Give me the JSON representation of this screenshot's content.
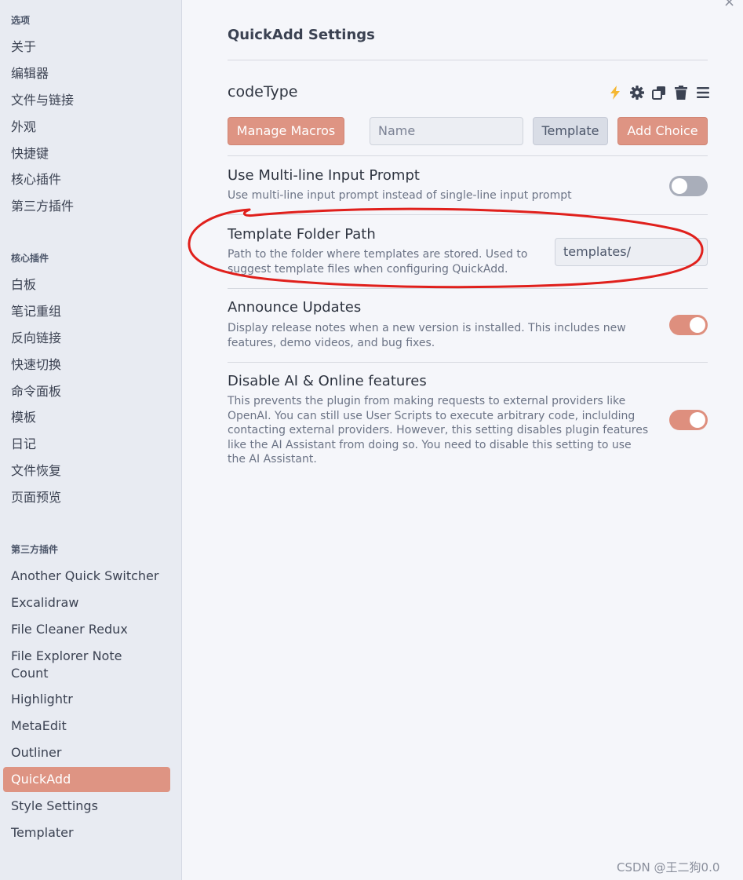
{
  "window": {
    "close_glyph": "×"
  },
  "sidebar": {
    "options_title": "选项",
    "options_items": [
      {
        "label": "关于"
      },
      {
        "label": "编辑器"
      },
      {
        "label": "文件与链接"
      },
      {
        "label": "外观"
      },
      {
        "label": "快捷键"
      },
      {
        "label": "核心插件"
      },
      {
        "label": "第三方插件"
      }
    ],
    "core_title": "核心插件",
    "core_items": [
      {
        "label": "白板"
      },
      {
        "label": "笔记重组"
      },
      {
        "label": "反向链接"
      },
      {
        "label": "快速切换"
      },
      {
        "label": "命令面板"
      },
      {
        "label": "模板"
      },
      {
        "label": "日记"
      },
      {
        "label": "文件恢复"
      },
      {
        "label": "页面预览"
      }
    ],
    "community_title": "第三方插件",
    "community_items": [
      {
        "label": "Another Quick Switcher"
      },
      {
        "label": "Excalidraw"
      },
      {
        "label": "File Cleaner Redux"
      },
      {
        "label": "File Explorer Note Count"
      },
      {
        "label": "Highlightr"
      },
      {
        "label": "MetaEdit"
      },
      {
        "label": "Outliner"
      },
      {
        "label": "QuickAdd",
        "active": true
      },
      {
        "label": "Style Settings"
      },
      {
        "label": "Templater"
      }
    ]
  },
  "main": {
    "title": "QuickAdd Settings",
    "choice": {
      "name": "codeType",
      "icons": [
        "lightning-icon",
        "gear-icon",
        "duplicate-icon",
        "trash-icon",
        "menu-icon"
      ],
      "accent_icon_color": "#f5b731"
    },
    "toolbar": {
      "manage_macros": "Manage Macros",
      "name_placeholder": "Name",
      "template": "Template",
      "add_choice": "Add Choice"
    },
    "settings": {
      "multiline": {
        "name": "Use Multi-line Input Prompt",
        "desc": "Use multi-line input prompt instead of single-line input prompt",
        "enabled": false
      },
      "template_folder": {
        "name": "Template Folder Path",
        "desc": "Path to the folder where templates are stored. Used to suggest template files when configuring QuickAdd.",
        "value": "templates/"
      },
      "announce": {
        "name": "Announce Updates",
        "desc": "Display release notes when a new version is installed. This includes new features, demo videos, and bug fixes.",
        "enabled": true
      },
      "disable_ai": {
        "name": "Disable AI & Online features",
        "desc": "This prevents the plugin from making requests to external providers like OpenAI. You can still use User Scripts to execute arbitrary code, inclulding contacting external providers. However, this setting disables plugin features like the AI Assistant from doing so. You need to disable this setting to use the AI Assistant.",
        "enabled": true
      }
    }
  },
  "colors": {
    "accent": "#de9483",
    "annotation": "#e0201c",
    "toggle_off": "#a9aeba"
  },
  "watermark": "CSDN @王二狗0.0"
}
